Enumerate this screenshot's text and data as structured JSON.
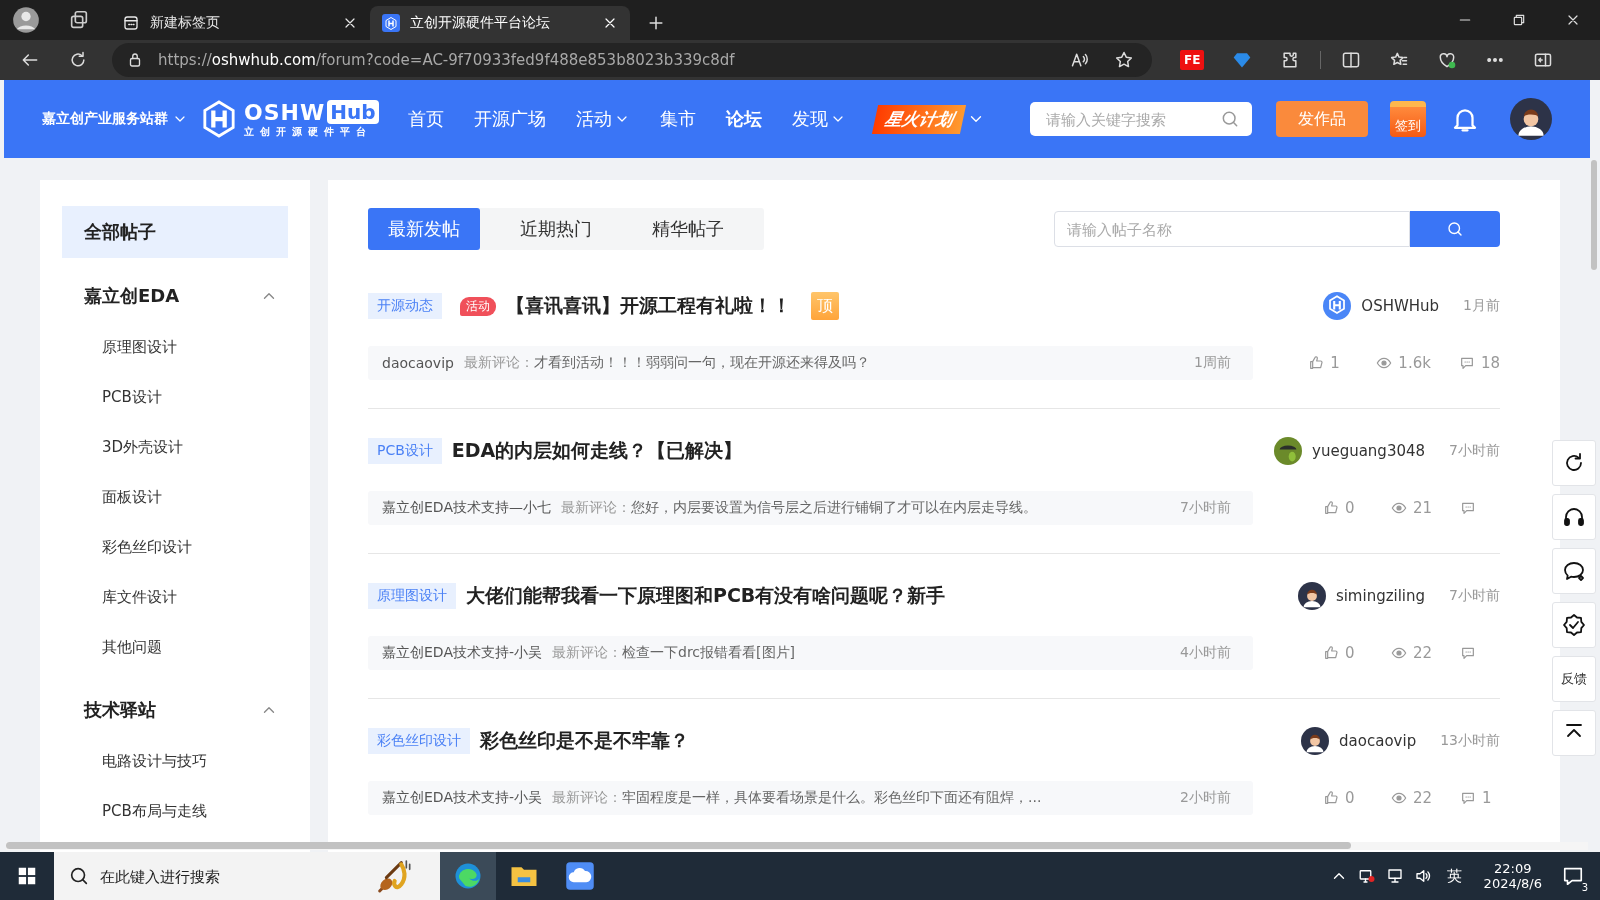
{
  "browser": {
    "tabs": [
      {
        "title": "新建标签页",
        "kind": "newtab",
        "selected": false
      },
      {
        "title": "立创开源硬件平台论坛",
        "kind": "site",
        "selected": true
      }
    ],
    "url": {
      "scheme": "https://",
      "host": "oshwhub.com",
      "path": "/forum?code=AC-9f70933fed9f488e853b8023b339c8df"
    },
    "extension_label": "FE"
  },
  "site_header": {
    "group_switch": "嘉立创产业服务站群",
    "logo": {
      "name": "OSHW",
      "badge": "Hub",
      "subtitle": "立创开源硬件平台"
    },
    "nav": [
      {
        "label": "首页",
        "dropdown": false,
        "selected": false
      },
      {
        "label": "开源广场",
        "dropdown": false,
        "selected": false
      },
      {
        "label": "活动",
        "dropdown": true,
        "selected": false
      },
      {
        "label": "集市",
        "dropdown": false,
        "selected": false
      },
      {
        "label": "论坛",
        "dropdown": false,
        "selected": true
      },
      {
        "label": "发现",
        "dropdown": true,
        "selected": false
      }
    ],
    "spark": "星火计划",
    "search_placeholder": "请输入关键字搜索",
    "publish": "发作品",
    "checkin": "签到"
  },
  "sidebar": {
    "all": {
      "label": "全部帖子",
      "selected": true
    },
    "groups": [
      {
        "title": "嘉立创EDA",
        "expanded": true,
        "items": [
          "原理图设计",
          "PCB设计",
          "3D外壳设计",
          "面板设计",
          "彩色丝印设计",
          "库文件设计",
          "其他问题"
        ]
      },
      {
        "title": "技术驿站",
        "expanded": true,
        "items": [
          "电路设计与技巧",
          "PCB布局与走线"
        ]
      }
    ]
  },
  "main": {
    "tabs": [
      {
        "label": "最新发帖",
        "selected": true
      },
      {
        "label": "近期热门",
        "selected": false
      },
      {
        "label": "精华帖子",
        "selected": false
      }
    ],
    "search_placeholder": "请输入帖子名称",
    "posts": [
      {
        "category": "开源动态",
        "badge": "活动",
        "title": "【喜讯喜讯】开源工程有礼啦！！",
        "pin": "顶",
        "author": "OSHWHub",
        "avatar": {
          "kind": "logo"
        },
        "time": "1月前",
        "commenter": "daocaovip",
        "comment_label": "最新评论：",
        "comment": "才看到活动！！！弱弱问一句，现在开源还来得及吗？",
        "comment_time": "1周前",
        "likes": "1",
        "views": "1.6k",
        "comments": "18"
      },
      {
        "category": "PCB设计",
        "title": "EDA的内层如何走线？【已解决】",
        "author": "yueguang3048",
        "avatar": {
          "kind": "photo"
        },
        "time": "7小时前",
        "commenter": "嘉立创EDA技术支持—小七",
        "comment_label": "最新评论：",
        "comment": "您好，内层要设置为信号层之后进行铺铜了才可以在内层走导线。",
        "comment_time": "7小时前",
        "likes": "0",
        "views": "21"
      },
      {
        "category": "原理图设计",
        "title": "大佬们能帮我看一下原理图和PCB有没有啥问题呢？新手",
        "author": "simingziling",
        "avatar": {
          "kind": "person"
        },
        "time": "7小时前",
        "commenter": "嘉立创EDA技术支持-小吴",
        "comment_label": "最新评论：",
        "comment": "检查一下drc报错看看[图片]",
        "comment_time": "4小时前",
        "likes": "0",
        "views": "22"
      },
      {
        "category": "彩色丝印设计",
        "title": "彩色丝印是不是不牢靠？",
        "author": "daocaovip",
        "avatar": {
          "kind": "person"
        },
        "time": "13小时前",
        "commenter": "嘉立创EDA技术支持-小吴",
        "comment_label": "最新评论：",
        "comment": "牢固程度是一样，具体要看场景是什么。彩色丝印下面还有阻焊，...",
        "comment_time": "2小时前",
        "likes": "0",
        "views": "22",
        "comments": "1"
      }
    ]
  },
  "float_tools": [
    {
      "kind": "refresh"
    },
    {
      "kind": "headset"
    },
    {
      "kind": "chat"
    },
    {
      "kind": "badge"
    },
    {
      "kind": "text",
      "label": "反馈"
    },
    {
      "kind": "top"
    }
  ],
  "taskbar": {
    "search_placeholder": "在此键入进行搜索",
    "ime": "英",
    "time": "22:09",
    "date": "2024/8/6",
    "notifications": "3"
  }
}
